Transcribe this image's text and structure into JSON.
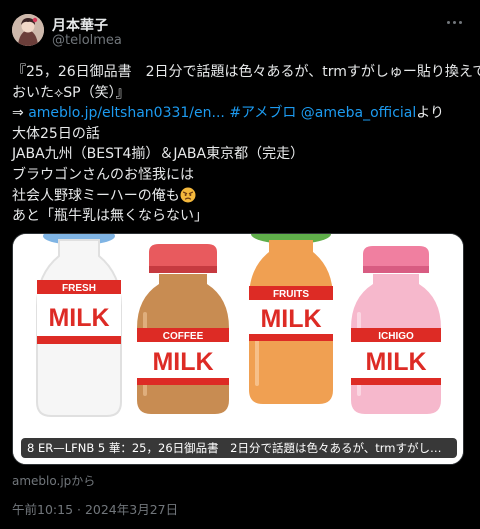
{
  "tweet": {
    "author_name": "月本華子",
    "author_handle": "@telolmea",
    "line1": "『25，26日御品書　2日分で話題は色々あるが、trmすがしゅー貼り換えて",
    "line2": "おいた⟡SP（笑）』",
    "arrow": "⇒ ",
    "link_url": "ameblo.jp/eltshan0331/en...",
    "link_hashtag": "#アメブロ",
    "link_mention": "@ameba_official",
    "line3_suffix": "より",
    "line4": "大体25日の話",
    "line5": "JABA九州（BEST4揃）＆JABA東京都（完走）",
    "line6": "ブラウゴンさんのお怪我には",
    "line7": "社会人野球ミーハーの俺も",
    "line8": "あと「瓶牛乳は無くならない」"
  },
  "card": {
    "caption": "8 ER—LFNB 5 華：25，26日御品書　2日分で話題は色々あるが、trmすがしゅー貼り換え...",
    "source": "ameblo.jpから",
    "image": {
      "labels": [
        "FRESH",
        "COFFEE",
        "FRUITS",
        "ICHIGO"
      ],
      "main_word": "MILK"
    }
  },
  "meta": {
    "timestamp": "午前10:15 · 2024年3月27日"
  },
  "colors": {
    "background": "#000000",
    "text": "#e7e9ea",
    "muted": "#71767b",
    "link": "#1d9bf0",
    "label_red": "#dd2b25"
  },
  "icons": {
    "more": "more-dots-icon",
    "emoji": "angry-face-emoji-icon"
  }
}
